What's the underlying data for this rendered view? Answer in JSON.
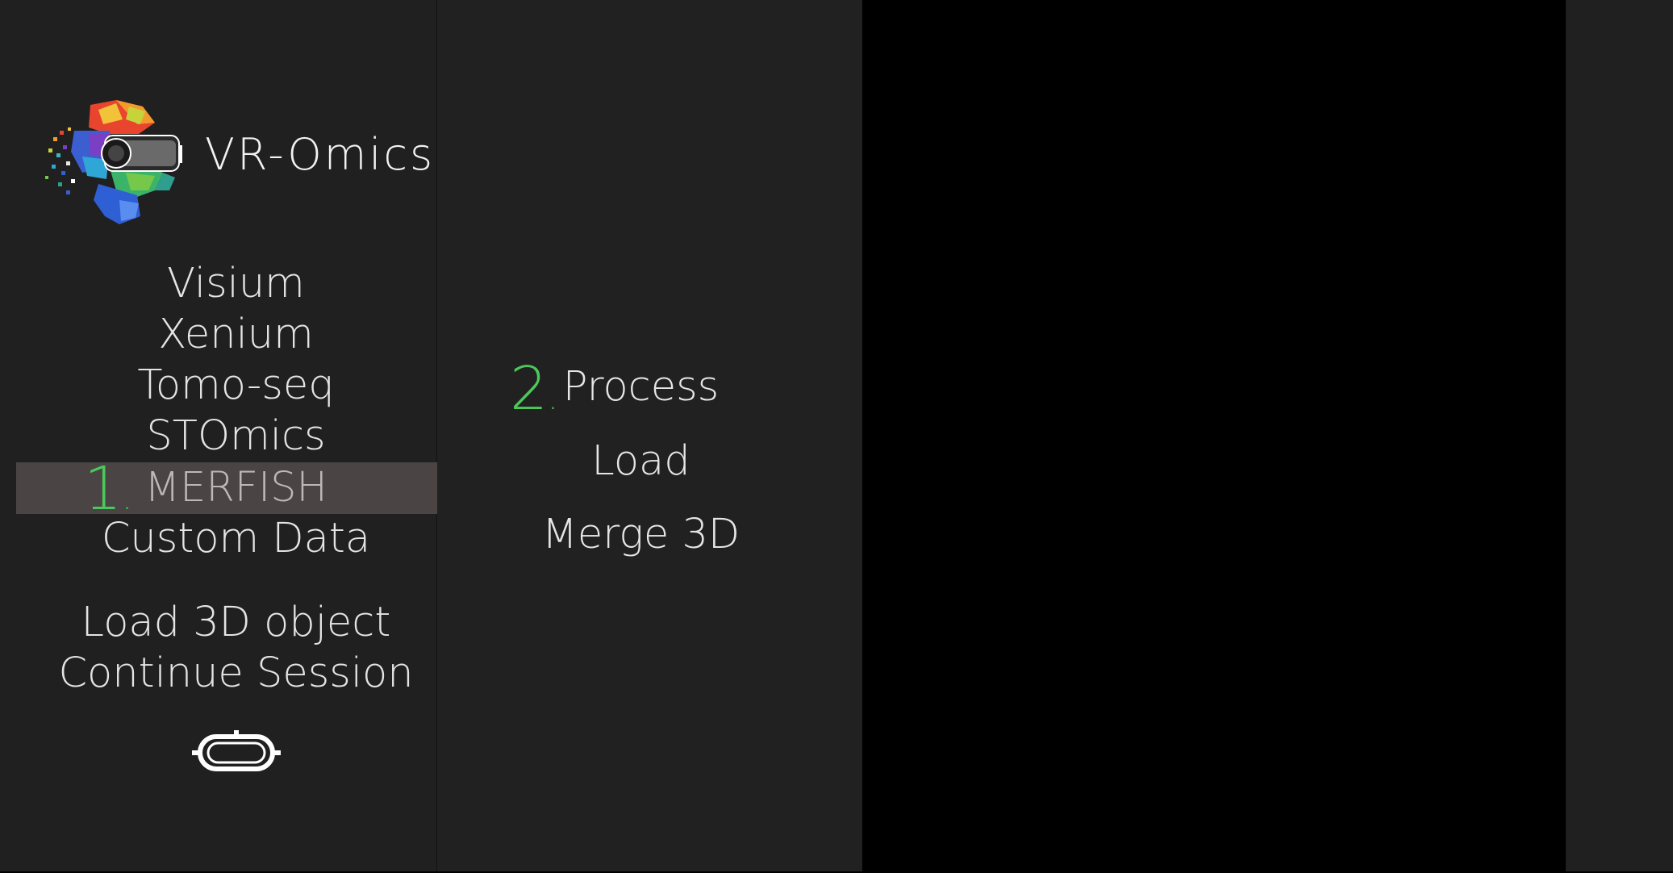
{
  "app": {
    "title": "VR-Omics"
  },
  "sidebar": {
    "items": [
      {
        "label": "Visium"
      },
      {
        "label": "Xenium"
      },
      {
        "label": "Tomo-seq"
      },
      {
        "label": "STOmics"
      },
      {
        "label": "MERFISH",
        "selected": true
      },
      {
        "label": "Custom Data"
      }
    ],
    "secondary_items": [
      {
        "label": "Load 3D object"
      },
      {
        "label": "Continue Session"
      }
    ],
    "step_marker": "1",
    "vr_icon": "vr-headset-icon"
  },
  "submenu": {
    "step_marker": "2",
    "items": [
      {
        "label": "Process"
      },
      {
        "label": "Load"
      },
      {
        "label": "Merge 3D"
      }
    ]
  },
  "colors": {
    "panel_bg": "#202020",
    "viewport_bg": "#000000",
    "step_green": "#4cc85a",
    "selected_bg": "#4a4444",
    "text": "#e4e4e4"
  }
}
